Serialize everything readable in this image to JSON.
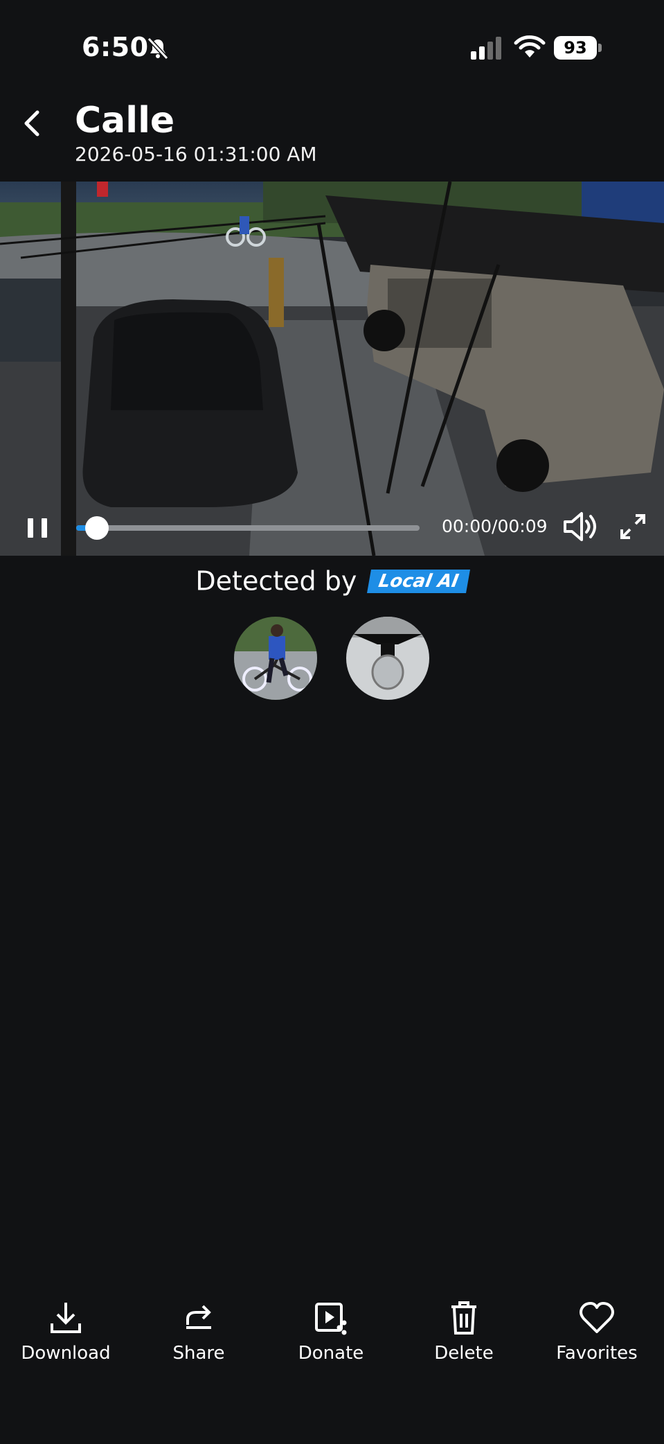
{
  "status_bar": {
    "time": "6:50",
    "battery": "93"
  },
  "header": {
    "title": "Calle",
    "subtitle": "2026-05-16 01:31:00 AM"
  },
  "player": {
    "time_readout": "00:00/00:09",
    "progress": 0.06
  },
  "detection": {
    "label": "Detected by",
    "badge": "Local AI"
  },
  "thumbnails": [
    {
      "icon": "cyclist-thumbnail"
    },
    {
      "icon": "light-bulb-thumbnail"
    }
  ],
  "actions": {
    "download": "Download",
    "share": "Share",
    "donate": "Donate",
    "delete": "Delete",
    "favorites": "Favorites"
  },
  "colors": {
    "accent": "#1e8ee6",
    "background": "#111214"
  }
}
